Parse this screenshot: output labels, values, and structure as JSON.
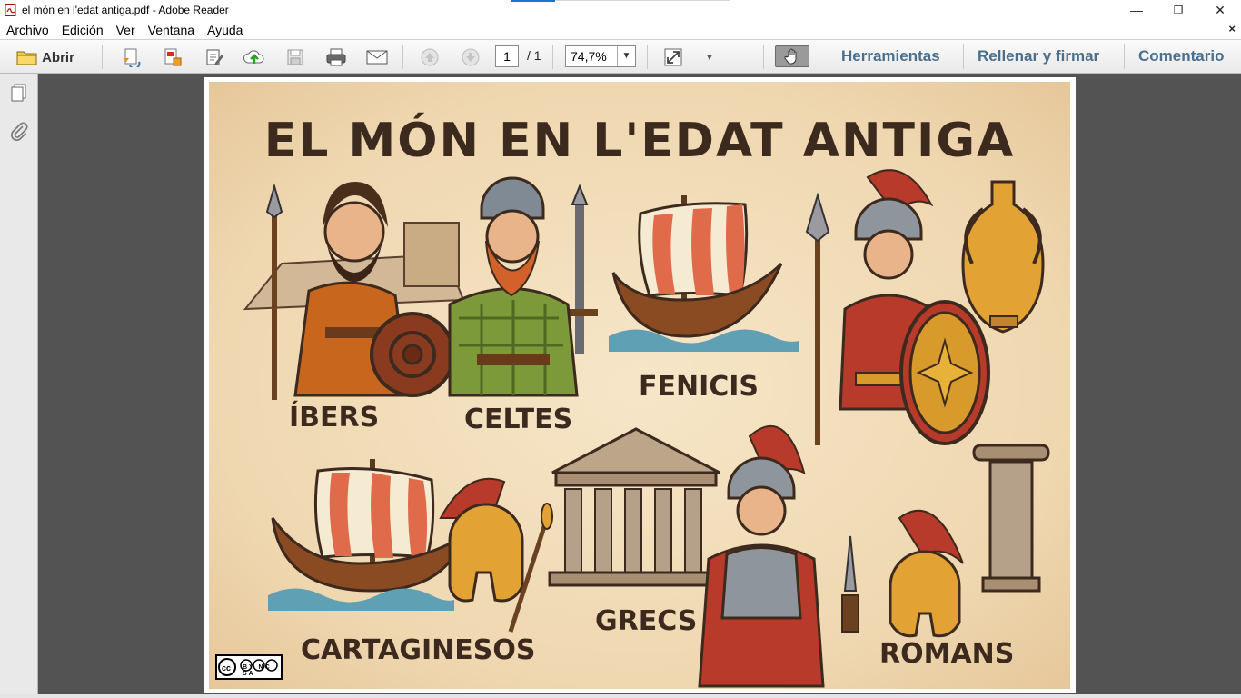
{
  "window": {
    "title": "el món en l'edat antiga.pdf - Adobe Reader",
    "minimize_glyph": "—",
    "restore_glyph": "❐",
    "close_glyph": "✕"
  },
  "menu": {
    "items": [
      "Archivo",
      "Edición",
      "Ver",
      "Ventana",
      "Ayuda"
    ],
    "close_doc": "×"
  },
  "toolbar": {
    "open_label": "Abrir",
    "page_current": "1",
    "page_total": "/ 1",
    "zoom": "74,7%",
    "panels": [
      "Herramientas",
      "Rellenar y firmar",
      "Comentario"
    ]
  },
  "poster": {
    "title": "EL MÓN EN L'EDAT ANTIGA",
    "labels": {
      "ibers": "ÍBERS",
      "celtes": "CELTES",
      "fenicis": "FENICIS",
      "cartaginesos": "CARTAGINESOS",
      "grecs": "GRECS",
      "romans": "ROMANS"
    },
    "license_text": "BY  NC  SA"
  },
  "colors": {
    "accent": "#4a6f8c",
    "poster_bg": "#f1dcb6",
    "ink": "#3d2a1e",
    "sail_red": "#e06b4a",
    "bronze": "#d89a2a",
    "roman_red": "#b83a2a"
  }
}
